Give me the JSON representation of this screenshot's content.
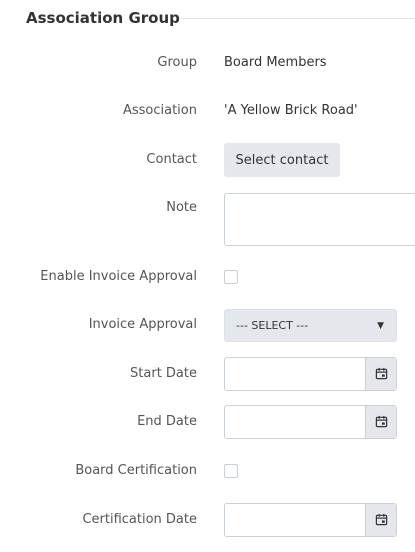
{
  "section": {
    "title": "Association Group"
  },
  "fields": {
    "group": {
      "label": "Group",
      "value": "Board Members"
    },
    "association": {
      "label": "Association",
      "value": "'A Yellow Brick Road'"
    },
    "contact": {
      "label": "Contact",
      "button_label": "Select contact"
    },
    "note": {
      "label": "Note",
      "value": ""
    },
    "enable_invoice_approval": {
      "label": "Enable Invoice Approval",
      "checked": false
    },
    "invoice_approval": {
      "label": "Invoice Approval",
      "selected": "--- SELECT ---"
    },
    "start_date": {
      "label": "Start Date",
      "value": ""
    },
    "end_date": {
      "label": "End Date",
      "value": ""
    },
    "board_certification": {
      "label": "Board Certification",
      "checked": false
    },
    "certification_date": {
      "label": "Certification Date",
      "value": ""
    }
  },
  "icons": {
    "date_picker": "calendar-icon",
    "select_caret": "caret-down-icon"
  },
  "colors": {
    "button_bg": "#e4e8ec",
    "border": "#c9d0d6",
    "label_text": "#555555",
    "section_line": "#dfe5ea"
  }
}
